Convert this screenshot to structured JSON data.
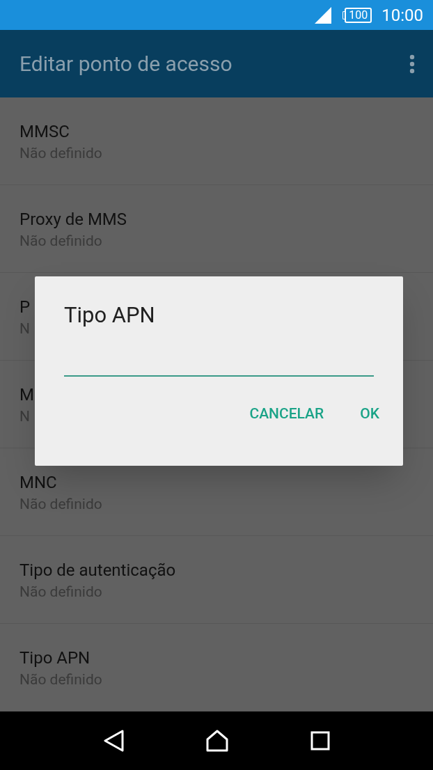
{
  "status_bar": {
    "battery": "100",
    "time": "10:00"
  },
  "app_bar": {
    "title": "Editar ponto de acesso"
  },
  "settings": [
    {
      "title": "MMSC",
      "value": "Não definido"
    },
    {
      "title": "Proxy de MMS",
      "value": "Não definido"
    },
    {
      "title": "P",
      "value": "N"
    },
    {
      "title": "M",
      "value": "N"
    },
    {
      "title": "MNC",
      "value": "Não definido"
    },
    {
      "title": "Tipo de autenticação",
      "value": "Não definido"
    },
    {
      "title": "Tipo APN",
      "value": "Não definido"
    }
  ],
  "dialog": {
    "title": "Tipo APN",
    "buttons": [
      "CANCELAR",
      "OK"
    ]
  }
}
